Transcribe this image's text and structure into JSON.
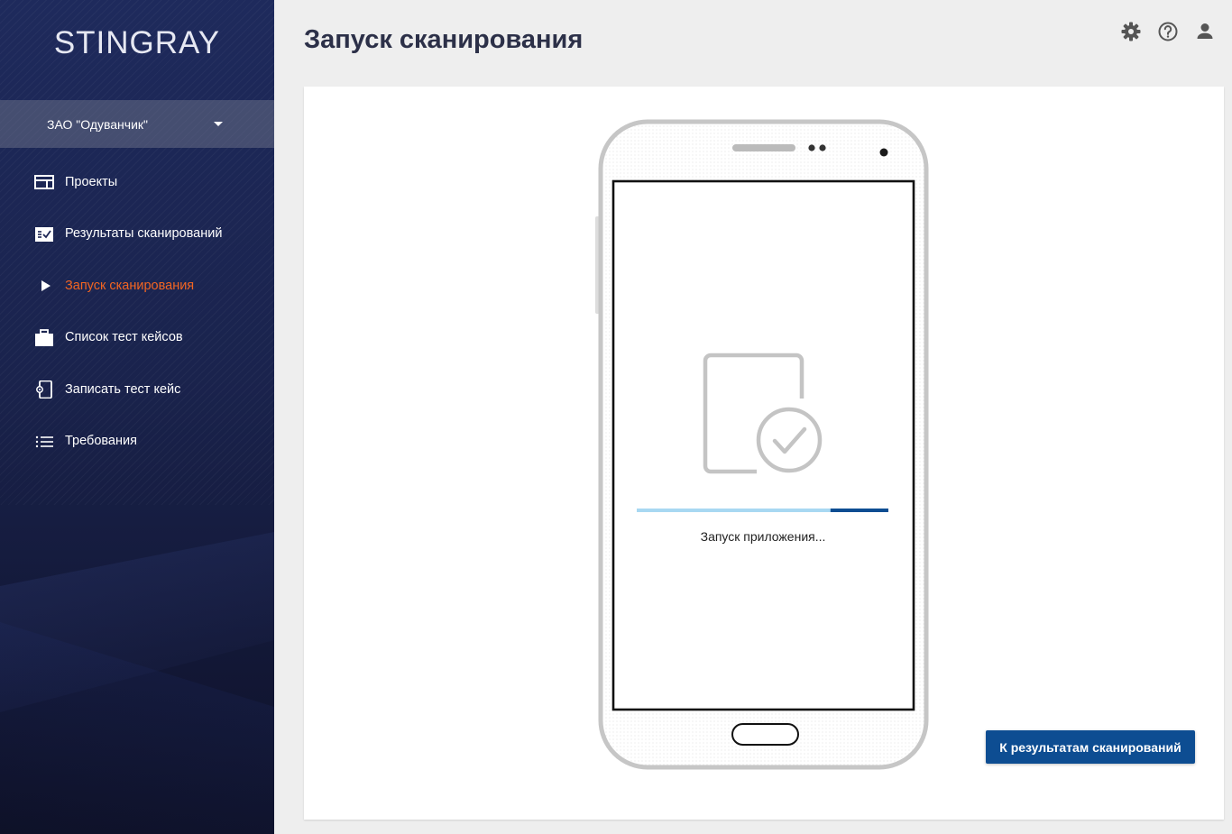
{
  "app": {
    "logo": "STINGRAY"
  },
  "sidebar": {
    "organization": "ЗАО \"Одуванчик\"",
    "items": [
      {
        "label": "Проекты",
        "icon": "projects-icon",
        "active": false
      },
      {
        "label": "Результаты сканирований",
        "icon": "scan-results-icon",
        "active": false
      },
      {
        "label": "Запуск сканирования",
        "icon": "play-icon",
        "active": true
      },
      {
        "label": "Список тест кейсов",
        "icon": "briefcase-icon",
        "active": false
      },
      {
        "label": "Записать тест кейс",
        "icon": "record-device-icon",
        "active": false
      },
      {
        "label": "Требования",
        "icon": "list-icon",
        "active": false
      }
    ]
  },
  "header": {
    "title": "Запуск сканирования",
    "icons": [
      "gear-icon",
      "help-icon",
      "user-icon"
    ]
  },
  "main": {
    "status_text": "Запуск приложения...",
    "progress": 0.77,
    "button_label": "К результатам сканирований"
  },
  "colors": {
    "accent_active": "#f26522",
    "button": "#0d4d92",
    "progress_track": "#a8d8f2",
    "progress_fill": "#0d4d92"
  }
}
